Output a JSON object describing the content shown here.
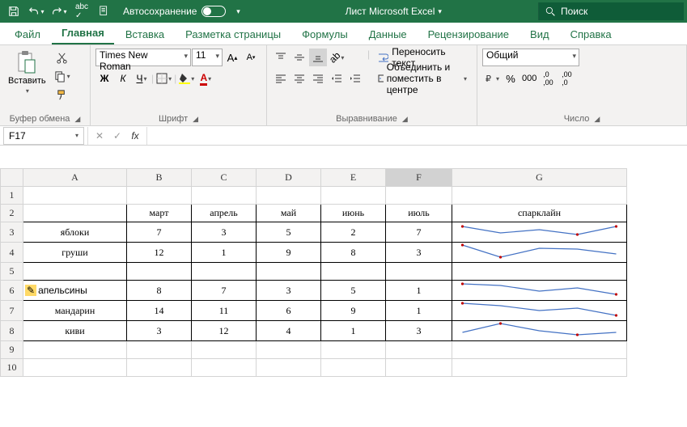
{
  "title": "Лист Microsoft Excel",
  "autosave_label": "Автосохранение",
  "search_label": "Поиск",
  "tabs": {
    "file": "Файл",
    "home": "Главная",
    "insert": "Вставка",
    "layout": "Разметка страницы",
    "formulas": "Формулы",
    "data": "Данные",
    "review": "Рецензирование",
    "view": "Вид",
    "help": "Справка"
  },
  "ribbon": {
    "clipboard": {
      "label": "Буфер обмена",
      "paste": "Вставить"
    },
    "font": {
      "label": "Шрифт",
      "name": "Times New Roman",
      "size": "11",
      "bold": "Ж",
      "italic": "К",
      "underline": "Ч"
    },
    "align": {
      "label": "Выравнивание",
      "wrap": "Переносить текст",
      "merge": "Объединить и поместить в центре"
    },
    "number": {
      "label": "Число",
      "format": "Общий"
    }
  },
  "name_box": "F17",
  "columns": [
    "A",
    "B",
    "C",
    "D",
    "E",
    "F",
    "G"
  ],
  "rows": [
    "1",
    "2",
    "3",
    "4",
    "5",
    "6",
    "7",
    "8",
    "9",
    "10"
  ],
  "table": {
    "headers": [
      "",
      "март",
      "апрель",
      "май",
      "июнь",
      "июль",
      "спарклайн"
    ],
    "r3": [
      "яблоки",
      "7",
      "3",
      "5",
      "2",
      "7"
    ],
    "r4": [
      "груши",
      "12",
      "1",
      "9",
      "8",
      "3"
    ],
    "r6": [
      "апельсины",
      "8",
      "7",
      "3",
      "5",
      "1"
    ],
    "r7": [
      "мандарин",
      "14",
      "11",
      "6",
      "9",
      "1"
    ],
    "r8": [
      "киви",
      "3",
      "12",
      "4",
      "1",
      "3"
    ]
  }
}
